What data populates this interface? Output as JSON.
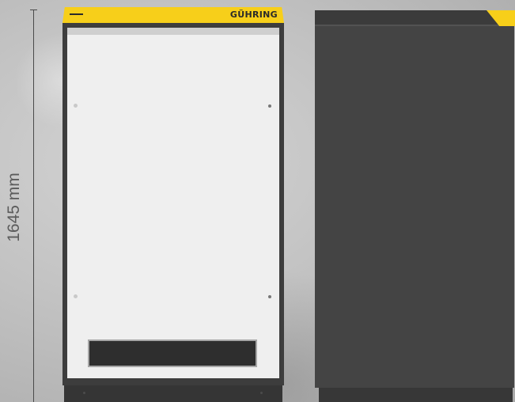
{
  "dimension": {
    "height_label": "1645 mm"
  },
  "front_cabinet": {
    "brand": "GÜHRING"
  },
  "colors": {
    "accent_yellow": "#f7cf1a",
    "cabinet_dark": "#3d3d3d",
    "panel_light": "#efefef"
  }
}
